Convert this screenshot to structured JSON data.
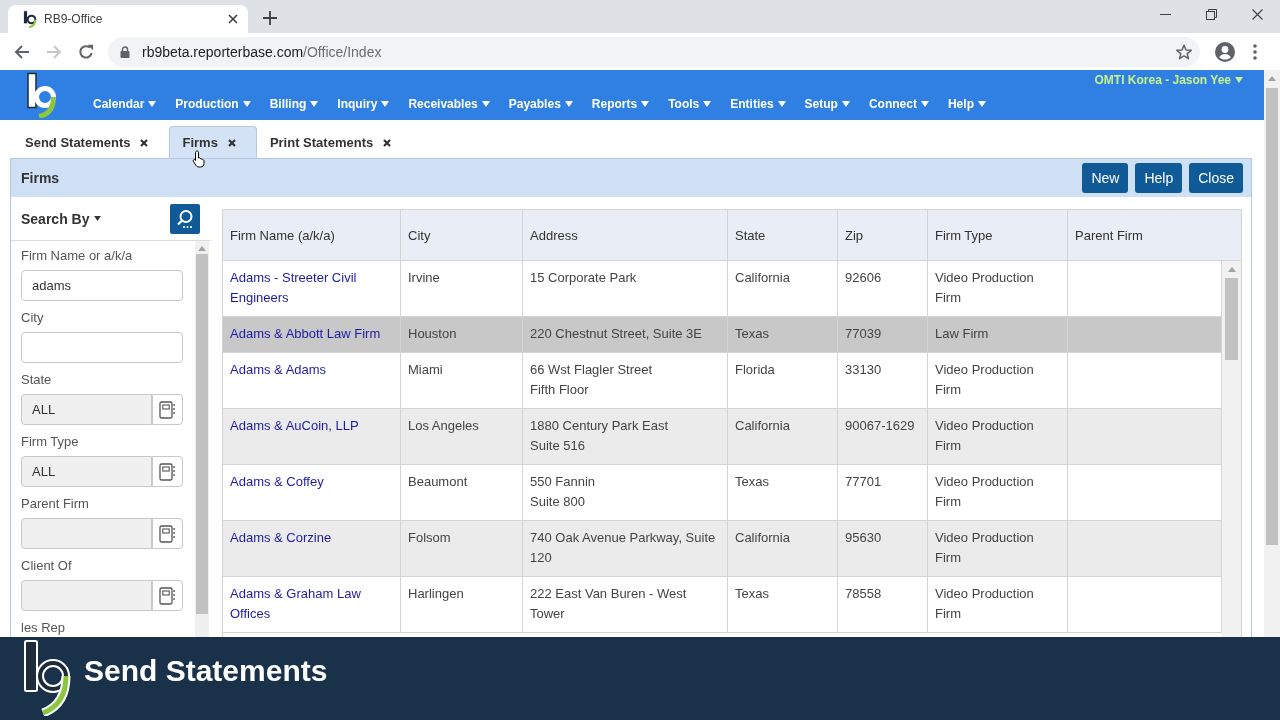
{
  "browser": {
    "tab_title": "RB9-Office",
    "url_host": "rb9beta.reporterbase.com",
    "url_path": "/Office/Index",
    "forward_disabled": true
  },
  "app": {
    "user": "OMTI Korea - Jason Yee",
    "menu": [
      "Calendar",
      "Production",
      "Billing",
      "Inquiry",
      "Receivables",
      "Payables",
      "Reports",
      "Tools",
      "Entities",
      "Setup",
      "Connect",
      "Help"
    ]
  },
  "tabs": [
    {
      "label": "Send Statements",
      "selected": false
    },
    {
      "label": "Firms",
      "selected": true
    },
    {
      "label": "Print Statements",
      "selected": false
    }
  ],
  "panel": {
    "title": "Firms",
    "buttons": [
      "New",
      "Help",
      "Close"
    ]
  },
  "search": {
    "title": "Search By",
    "fields": [
      {
        "label": "Firm Name or a/k/a",
        "kind": "text",
        "value": "adams"
      },
      {
        "label": "City",
        "kind": "text"
      },
      {
        "label": "State",
        "kind": "lookup",
        "value": "ALL"
      },
      {
        "label": "Firm Type",
        "kind": "lookup",
        "value": "ALL"
      },
      {
        "label": "Parent Firm",
        "kind": "lookup"
      },
      {
        "label": "Client Of",
        "kind": "lookup"
      },
      {
        "label": "les Rep",
        "kind": "cut"
      }
    ]
  },
  "table": {
    "columns": [
      "Firm Name (a/k/a)",
      "City",
      "Address",
      "State",
      "Zip",
      "Firm Type",
      "Parent Firm"
    ],
    "rows": [
      {
        "cells": [
          "Adams - Streeter Civil Engineers",
          "Irvine",
          "15 Corporate Park",
          "California",
          "92606",
          "Video Production Firm"
        ],
        "selected": false
      },
      {
        "cells": [
          "Adams & Abbott Law Firm",
          "Houston",
          "220 Chestnut Street, Suite 3E",
          "Texas",
          "77039",
          "Law Firm"
        ],
        "selected": true
      },
      {
        "cells": [
          "Adams & Adams",
          "Miami",
          "66 Wst Flagler Street\nFifth Floor",
          "Florida",
          "33130",
          "Video Production Firm"
        ],
        "selected": false
      },
      {
        "cells": [
          "Adams & AuCoin, LLP",
          "Los Angeles",
          "1880 Century Park East\nSuite 516",
          "California",
          "90067-1629",
          "Video Production Firm"
        ],
        "selected": false
      },
      {
        "cells": [
          "Adams & Coffey",
          "Beaumont",
          "550 Fannin\nSuite 800",
          "Texas",
          "77701",
          "Video Production Firm"
        ],
        "selected": false
      },
      {
        "cells": [
          "Adams & Corzine",
          "Folsom",
          "740 Oak Avenue Parkway, Suite 120",
          "California",
          "95630",
          "Video Production Firm"
        ],
        "selected": false
      },
      {
        "cells": [
          "Adams & Graham Law Offices",
          "Harlingen",
          "222 East Van Buren - West Tower",
          "Texas",
          "78558",
          "Video Production Firm"
        ],
        "selected": false
      }
    ]
  },
  "banner": {
    "title": "Send Statements"
  }
}
